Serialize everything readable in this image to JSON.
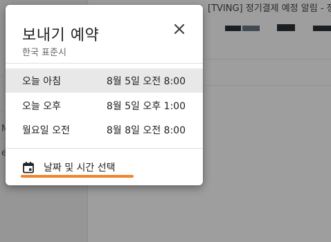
{
  "background": {
    "subject_text": "[TVING] 정기결제 예정 알림 - 정기결제 예정 내역을 안",
    "rail_letters": [
      "M",
      "e"
    ]
  },
  "dialog": {
    "title": "보내기 예약",
    "subtitle": "한국 표준시",
    "options": [
      {
        "label": "오늘 아침",
        "time": "8월 5일 오전 8:00",
        "selected": true
      },
      {
        "label": "오늘 오후",
        "time": "8월 5일 오후 1:00",
        "selected": false
      },
      {
        "label": "월요일 오전",
        "time": "8월 8일 오전 8:00",
        "selected": false
      }
    ],
    "pick_datetime_label": "날짜 및 시간 선택",
    "icons": {
      "close": "close-icon",
      "calendar": "calendar-icon"
    }
  },
  "colors": {
    "highlight": "#f0832c",
    "selected_row": "#e8e8e8",
    "overlay": "rgba(0,0,0,0.38)"
  }
}
